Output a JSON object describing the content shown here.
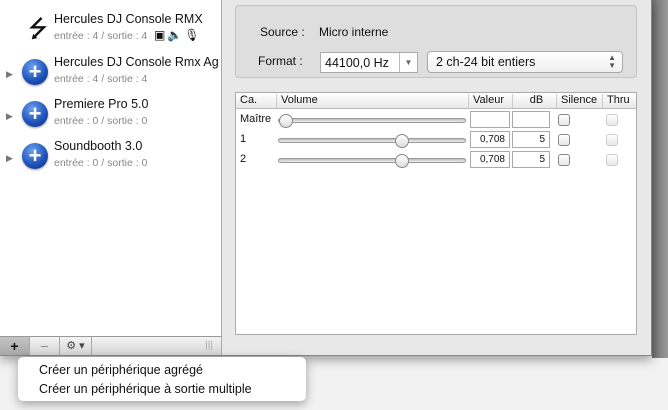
{
  "devices": [
    {
      "name": "Hercules DJ Console RMX",
      "io": "entrée : 4 / sortie : 4",
      "icon": "usb-icon",
      "badges": [
        "finder-icon",
        "speaker-icon",
        "microphone-icon"
      ]
    },
    {
      "name": "Hercules DJ Console Rmx Ag",
      "io": "entrée : 4 / sortie : 4",
      "icon": "aggregate-device-icon"
    },
    {
      "name": "Premiere Pro 5.0",
      "io": "entrée : 0 / sortie : 0",
      "icon": "aggregate-device-icon"
    },
    {
      "name": "Soundbooth 3.0",
      "io": "entrée : 0 / sortie : 0",
      "icon": "aggregate-device-icon"
    }
  ],
  "toolbar": {
    "add": "+",
    "remove": "−",
    "gear": "⚙ ▾",
    "grip": "|||"
  },
  "source": {
    "label": "Source :",
    "value": "Micro interne"
  },
  "format": {
    "label": "Format :",
    "rate": "44100,0 Hz",
    "channels": "2 ch-24 bit entiers"
  },
  "table": {
    "headers": {
      "ch": "Ca.",
      "volume": "Volume",
      "value": "Valeur",
      "db": "dB",
      "mute": "Silence",
      "thru": "Thru"
    },
    "rows": [
      {
        "ch": "Maître",
        "volume": 0,
        "value": "",
        "db": "",
        "mute": false,
        "thru": false
      },
      {
        "ch": "1",
        "volume": 0.708,
        "value": "0,708",
        "db": "5",
        "mute": false,
        "thru": false
      },
      {
        "ch": "2",
        "volume": 0.708,
        "value": "0,708",
        "db": "5",
        "mute": false,
        "thru": false
      }
    ]
  },
  "menu": [
    "Créer un périphérique agrégé",
    "Créer un périphérique à sortie multiple"
  ]
}
